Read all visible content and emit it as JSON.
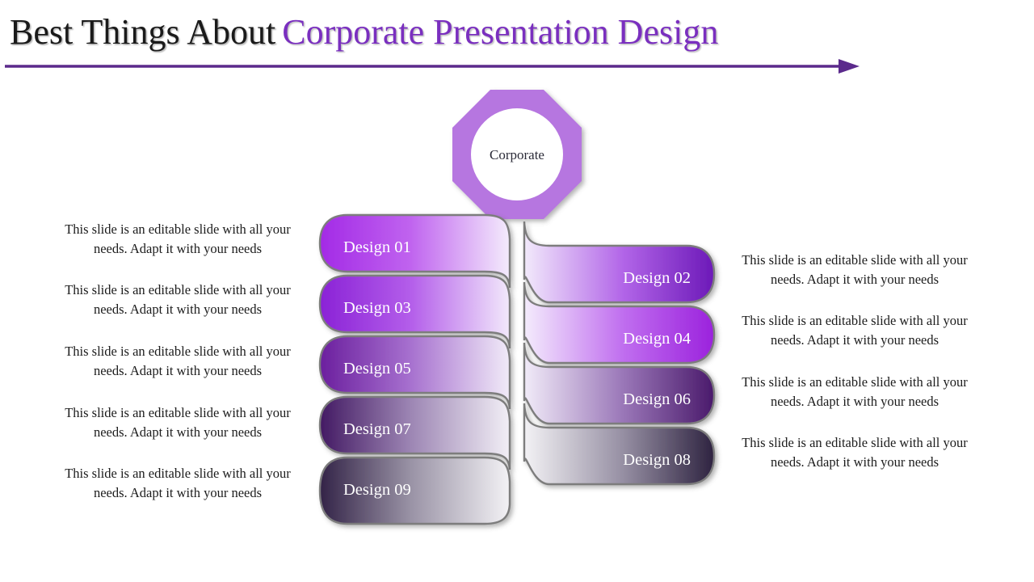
{
  "slide": {
    "background_color": "#ffffff",
    "title": {
      "plain_text": "Best Things About",
      "accent_text": "Corporate Presentation Design",
      "plain_color": "#1a1a1a",
      "accent_color": "#7a2fbf",
      "underline_arrow_color": "#5b2a8c"
    },
    "hub": {
      "label": "Corporate",
      "ring_color": "#b676e0",
      "fill_color": "#ffffff",
      "label_color": "#2b2b38",
      "shape": "octagon-ring-with-circle"
    },
    "bars_left": [
      {
        "label": "Design 01",
        "start_color": "#a32ae6",
        "end_color": "#f2eafb"
      },
      {
        "label": "Design 03",
        "start_color": "#8a22d6",
        "end_color": "#f0e8fa"
      },
      {
        "label": "Design 05",
        "start_color": "#6b1f9e",
        "end_color": "#efe9f7"
      },
      {
        "label": "Design 07",
        "start_color": "#431a63",
        "end_color": "#f0edf4"
      },
      {
        "label": "Design 09",
        "start_color": "#332347",
        "end_color": "#f1f0f3"
      }
    ],
    "bars_right": [
      {
        "label": "Design 02",
        "start_color": "#f0e8fb",
        "end_color": "#6c19b8"
      },
      {
        "label": "Design 04",
        "start_color": "#f2eafb",
        "end_color": "#9b22dd"
      },
      {
        "label": "Design 06",
        "start_color": "#efe9f7",
        "end_color": "#4a1a6b"
      },
      {
        "label": "Design 08",
        "start_color": "#f1f0f3",
        "end_color": "#2e2340"
      }
    ],
    "descriptions_left": [
      "This slide is an editable slide with all your needs. Adapt it with your needs",
      "This slide is an editable slide with all your needs. Adapt it with your needs",
      "This slide is an editable slide with all your needs. Adapt it with your needs",
      "This slide is an editable slide with all your needs. Adapt it with your needs",
      "This slide is an editable slide with all your needs. Adapt it with your needs"
    ],
    "descriptions_right": [
      "This slide is an editable slide with all your needs. Adapt it with your needs",
      "This slide is an editable slide with all your needs. Adapt it with your needs",
      "This slide is an editable slide with all your needs. Adapt it with your needs",
      "This slide is an editable slide with all your needs. Adapt it with your needs"
    ]
  }
}
